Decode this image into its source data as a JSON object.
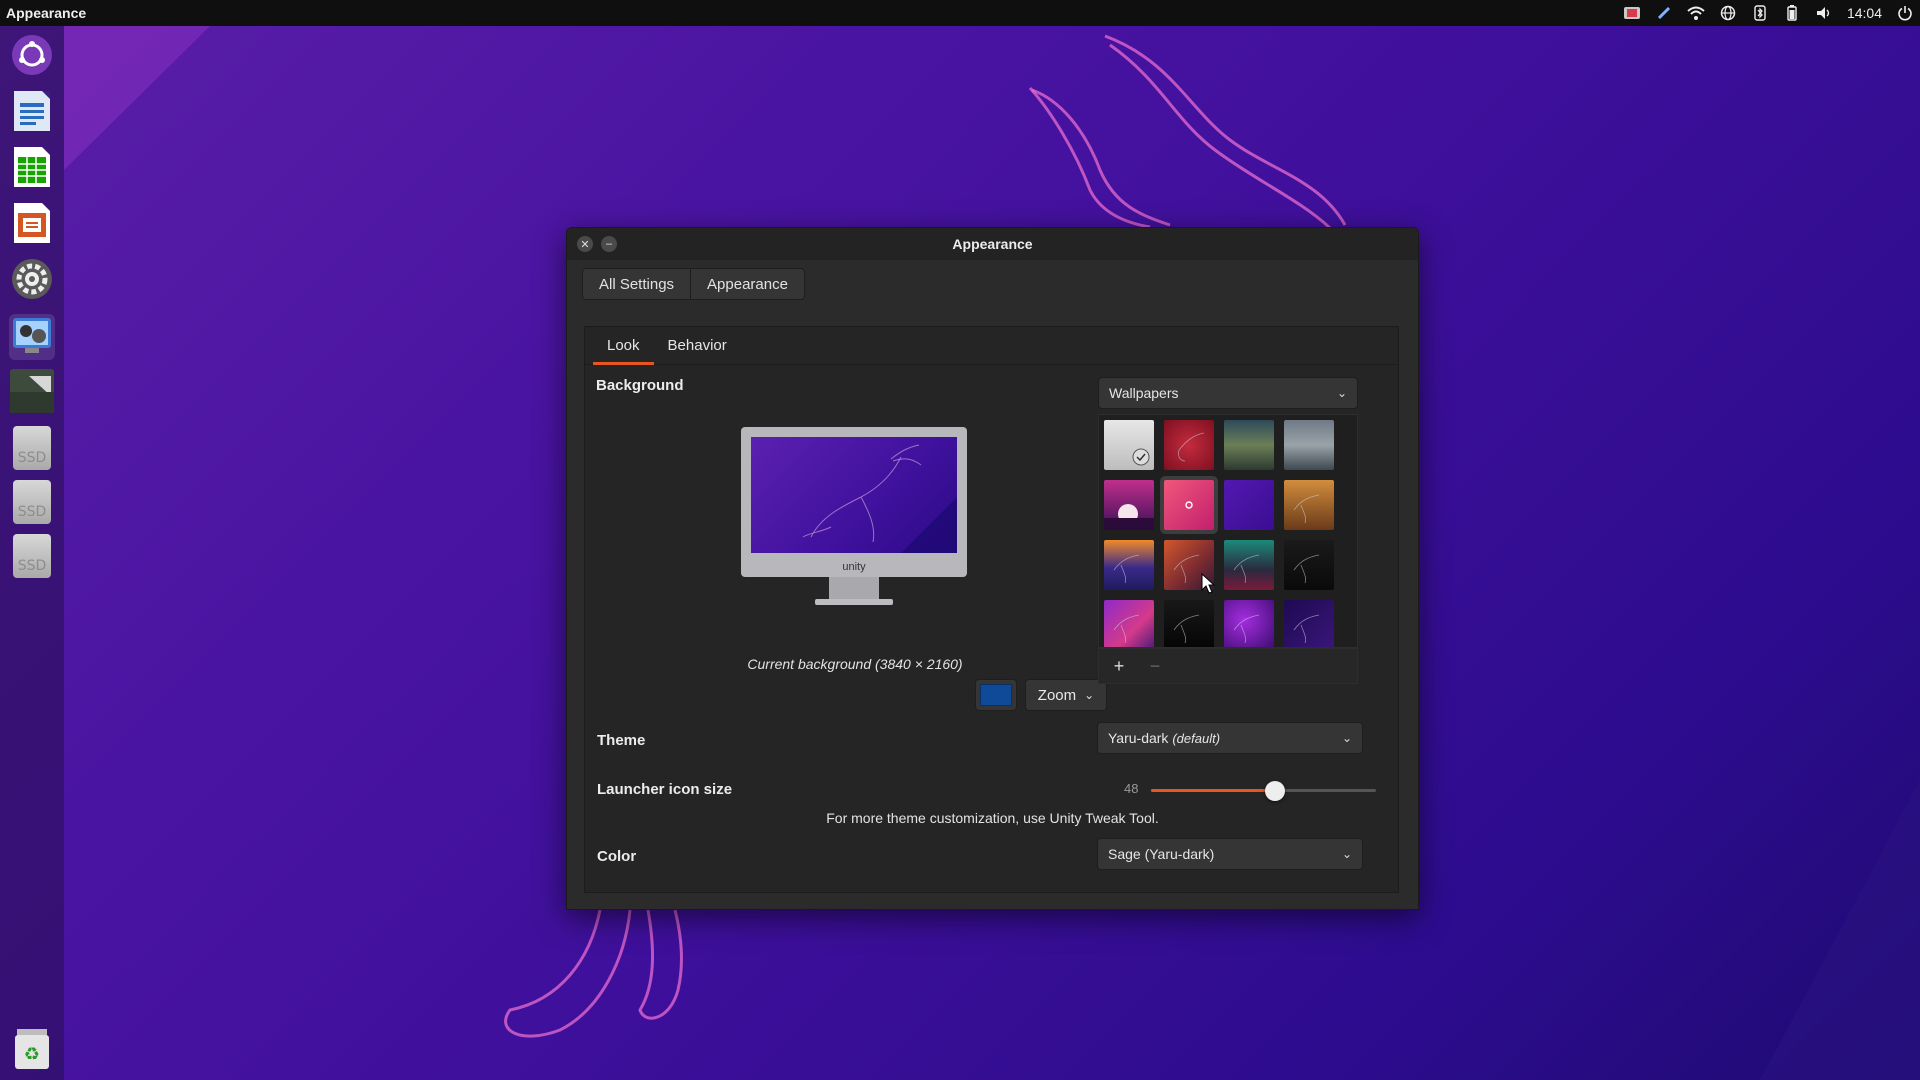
{
  "top_panel": {
    "app_name": "Appearance",
    "clock": "14:04"
  },
  "launcher": {
    "items": [
      {
        "name": "ubuntu-logo-icon"
      },
      {
        "name": "libreoffice-writer-icon"
      },
      {
        "name": "libreoffice-calc-icon"
      },
      {
        "name": "libreoffice-impress-icon"
      },
      {
        "name": "system-settings-icon"
      },
      {
        "name": "shotwell-icon"
      },
      {
        "name": "files-icon"
      }
    ],
    "drives": [
      "SSD",
      "SSD",
      "SSD"
    ]
  },
  "window": {
    "title": "Appearance",
    "breadcrumbs": [
      "All Settings",
      "Appearance"
    ],
    "tabs": [
      "Look",
      "Behavior"
    ],
    "active_tab": "Look",
    "background": {
      "label": "Background",
      "monitor_brand": "unity",
      "current_caption": "Current background (3840 × 2160)",
      "color_value": "#0f4a99",
      "mode": "Zoom",
      "source": "Wallpapers",
      "add_label": "+",
      "remove_label": "−"
    },
    "theme": {
      "label": "Theme",
      "value": "Yaru-dark",
      "suffix": "(default)"
    },
    "launcher_icon_size": {
      "label": "Launcher icon size",
      "value": "48",
      "fraction": 0.55
    },
    "note": "For more theme customization, use Unity Tweak Tool.",
    "color": {
      "label": "Color",
      "value": "Sage (Yaru-dark)"
    }
  },
  "accent": "#e95420"
}
